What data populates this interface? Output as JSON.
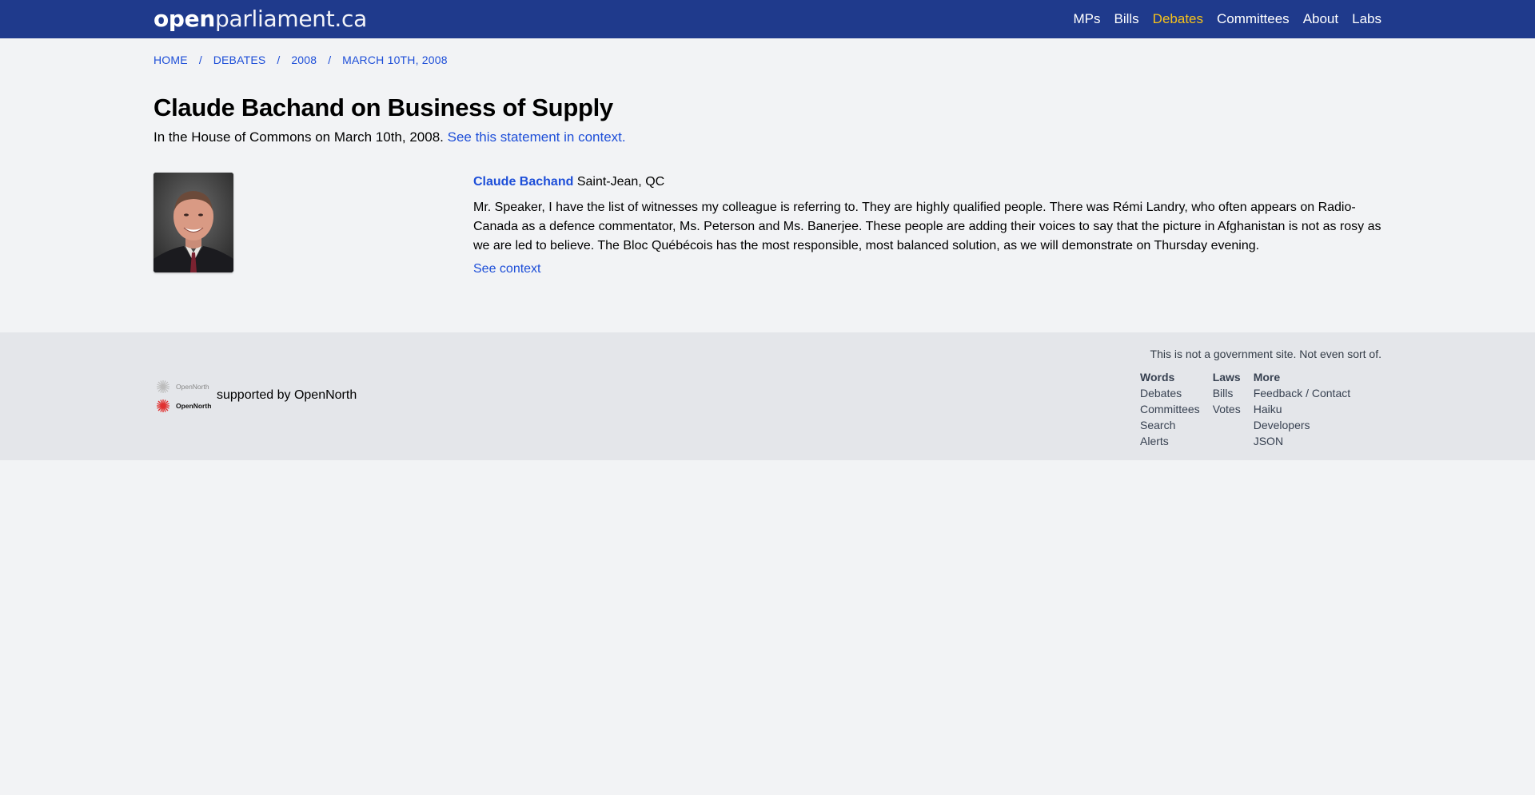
{
  "site": {
    "logo_bold": "open",
    "logo_light": "parliament.ca"
  },
  "nav": {
    "items": [
      {
        "label": "MPs"
      },
      {
        "label": "Bills"
      },
      {
        "label": "Debates"
      },
      {
        "label": "Committees"
      },
      {
        "label": "About"
      },
      {
        "label": "Labs"
      }
    ],
    "active": "Debates",
    "active_color": "#f6c21b",
    "bar_color": "#1f3a8c"
  },
  "breadcrumb": {
    "items": [
      "HOME",
      "DEBATES",
      "2008",
      "MARCH 10TH, 2008"
    ],
    "separator": "/"
  },
  "page": {
    "title": "Claude Bachand on Business of Supply",
    "subtitle": "In the House of Commons on March 10th, 2008.",
    "context_link": "See this statement in context."
  },
  "statement": {
    "speaker_name": "Claude Bachand",
    "riding": "Saint-Jean, QC",
    "text": "Mr. Speaker, I have the list of witnesses my colleague is referring to. They are highly qualified people. There was Rémi Landry, who often appears on Radio-Canada as a defence commentator, Ms. Peterson and Ms. Banerjee. These people are adding their voices to say that the picture in Afghanistan is not as rosy as we are led to believe. The Bloc Québécois has the most responsible, most balanced solution, as we will demonstrate on Thursday evening.",
    "see_context": "See context"
  },
  "footer": {
    "supported_by": "supported by OpenNorth",
    "logo_text": "OpenNorth",
    "disclaimer": "This is not a government site. Not even sort of.",
    "columns": [
      {
        "heading": "Words",
        "links": [
          "Debates",
          "Committees",
          "Search",
          "Alerts"
        ]
      },
      {
        "heading": "Laws",
        "links": [
          "Bills",
          "Votes"
        ]
      },
      {
        "heading": "More",
        "links": [
          "Feedback / Contact",
          "Haiku",
          "Developers",
          "JSON"
        ]
      }
    ]
  },
  "colors": {
    "link": "#1d4ed8",
    "background": "#f2f3f5",
    "footer_bg": "#e4e6ea"
  }
}
